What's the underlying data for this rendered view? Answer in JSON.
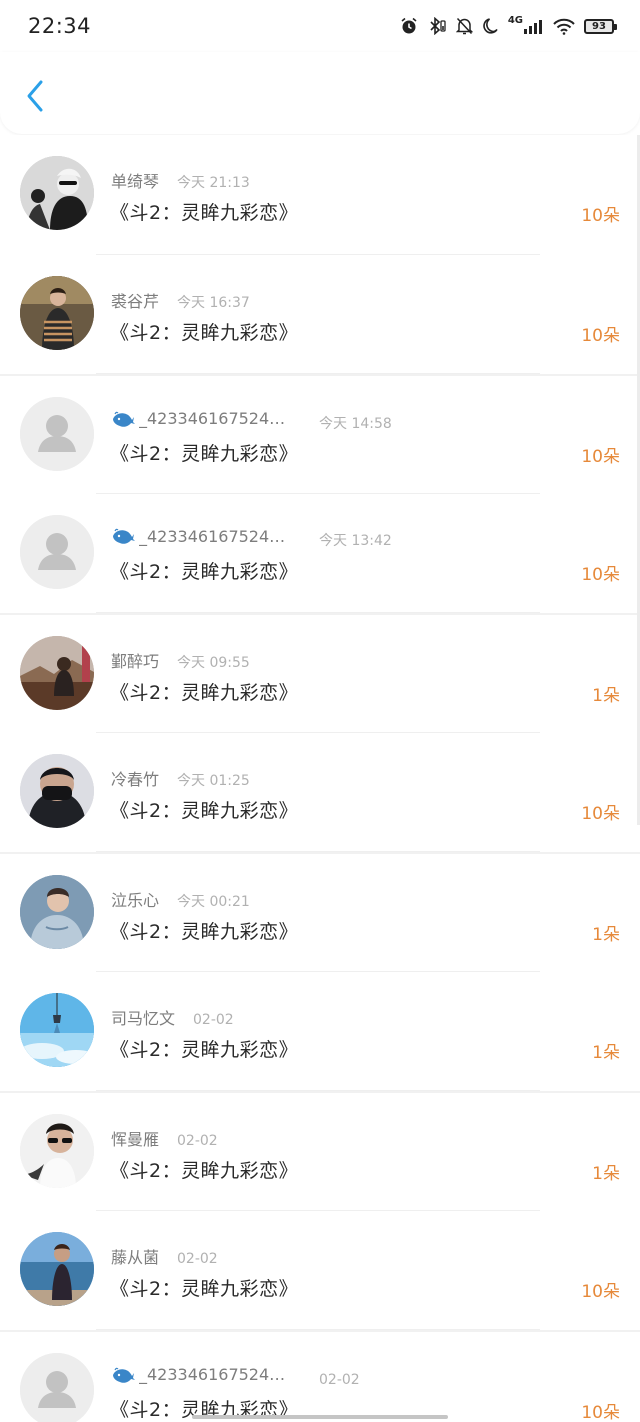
{
  "status_bar": {
    "time": "22:34",
    "network": "4G",
    "battery": "93",
    "icons": [
      "alarm-icon",
      "bluetooth-icon",
      "mute-icon",
      "moon-icon",
      "signal-icon",
      "wifi-icon",
      "battery-icon"
    ]
  },
  "header": {
    "back_icon": "chevron-left-icon",
    "accent": "#2aa0e8"
  },
  "colors": {
    "count": "#e6893a",
    "time": "#b1b1b1",
    "name": "#7d7d7d"
  },
  "items": [
    {
      "name": "单绮琴",
      "time": "今天 21:13",
      "title": "《斗2：灵眸九彩恋》",
      "count": "10朵",
      "avatar": "photo-bw"
    },
    {
      "name": "裘谷芹",
      "time": "今天 16:37",
      "title": "《斗2：灵眸九彩恋》",
      "count": "10朵",
      "avatar": "photo-woman-stripes"
    },
    {
      "name": "_4233461675248…",
      "time": "今天 14:58",
      "title": "《斗2：灵眸九彩恋》",
      "count": "10朵",
      "avatar": "placeholder",
      "wechat": true
    },
    {
      "name": "_4233461675248…",
      "time": "今天 13:42",
      "title": "《斗2：灵眸九彩恋》",
      "count": "10朵",
      "avatar": "placeholder",
      "wechat": true
    },
    {
      "name": "鄞醉巧",
      "time": "今天 09:55",
      "title": "《斗2：灵眸九彩恋》",
      "count": "1朵",
      "avatar": "photo-outdoor"
    },
    {
      "name": "冷春竹",
      "time": "今天 01:25",
      "title": "《斗2：灵眸九彩恋》",
      "count": "10朵",
      "avatar": "photo-mask"
    },
    {
      "name": "泣乐心",
      "time": "今天 00:21",
      "title": "《斗2：灵眸九彩恋》",
      "count": "1朵",
      "avatar": "photo-hoodie"
    },
    {
      "name": "司马忆文",
      "time": "02-02",
      "title": "《斗2：灵眸九彩恋》",
      "count": "1朵",
      "avatar": "photo-sky"
    },
    {
      "name": "恽曼雁",
      "time": "02-02",
      "title": "《斗2：灵眸九彩恋》",
      "count": "1朵",
      "avatar": "photo-sunglasses"
    },
    {
      "name": "藤从菌",
      "time": "02-02",
      "title": "《斗2：灵眸九彩恋》",
      "count": "10朵",
      "avatar": "photo-seaside"
    },
    {
      "name": "_4233461675248…",
      "time": "02-02",
      "title": "《斗2：灵眸九彩恋》",
      "count": "10朵",
      "avatar": "placeholder",
      "wechat": true
    }
  ]
}
